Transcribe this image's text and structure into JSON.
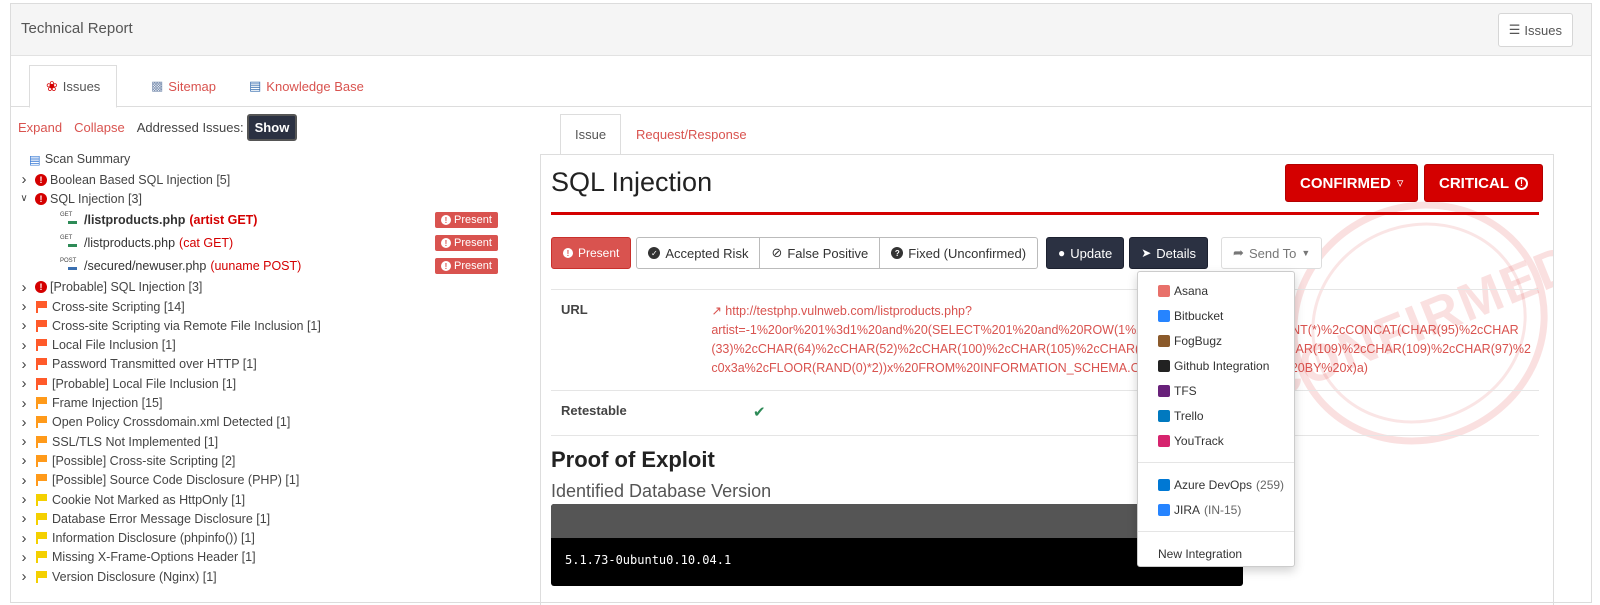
{
  "header": {
    "title": "Technical Report",
    "issues_button": "Issues"
  },
  "tabs_top": [
    {
      "label": "Issues",
      "icon": "bug-icon"
    },
    {
      "label": "Sitemap",
      "icon": "sitemap-icon"
    },
    {
      "label": "Knowledge Base",
      "icon": "book-icon"
    }
  ],
  "controls": {
    "expand": "Expand",
    "collapse": "Collapse",
    "addressed_label": "Addressed Issues:",
    "toggle": "Show"
  },
  "tree": {
    "summary": "Scan Summary",
    "items": [
      {
        "label": "Boolean Based SQL Injection [5]",
        "icon": "critical"
      },
      {
        "label": "SQL Injection [3]",
        "icon": "critical",
        "expanded": true
      },
      {
        "label": "[Probable] SQL Injection [3]",
        "icon": "critical"
      },
      {
        "label": "Cross-site Scripting [14]",
        "icon": "red"
      },
      {
        "label": "Cross-site Scripting via Remote File Inclusion [1]",
        "icon": "red"
      },
      {
        "label": "Local File Inclusion [1]",
        "icon": "red"
      },
      {
        "label": "Password Transmitted over HTTP [1]",
        "icon": "red"
      },
      {
        "label": "[Probable] Local File Inclusion [1]",
        "icon": "red"
      },
      {
        "label": "Frame Injection [15]",
        "icon": "orange"
      },
      {
        "label": "Open Policy Crossdomain.xml Detected [1]",
        "icon": "orange"
      },
      {
        "label": "SSL/TLS Not Implemented [1]",
        "icon": "orange"
      },
      {
        "label": "[Possible] Cross-site Scripting [2]",
        "icon": "orange"
      },
      {
        "label": "[Possible] Source Code Disclosure (PHP) [1]",
        "icon": "orange"
      },
      {
        "label": "Cookie Not Marked as HttpOnly [1]",
        "icon": "yellow"
      },
      {
        "label": "Database Error Message Disclosure [1]",
        "icon": "yellow"
      },
      {
        "label": "Information Disclosure (phpinfo()) [1]",
        "icon": "yellow"
      },
      {
        "label": "Missing X-Frame-Options Header [1]",
        "icon": "yellow"
      },
      {
        "label": "Version Disclosure (Nginx) [1]",
        "icon": "yellow"
      }
    ],
    "sub_items": [
      {
        "method": "GET",
        "path": "/listproducts.php",
        "param": "(artist GET)",
        "badge": "Present",
        "bold": true
      },
      {
        "method": "GET",
        "path": "/listproducts.php",
        "param": "(cat GET)",
        "badge": "Present"
      },
      {
        "method": "POST",
        "path": "/secured/newuser.php",
        "param": "(uuname POST)",
        "badge": "Present"
      }
    ]
  },
  "right_tabs": [
    "Issue",
    "Request/Response"
  ],
  "issue": {
    "title": "SQL Injection",
    "confirmed_badge": "CONFIRMED",
    "severity_badge": "CRITICAL",
    "stamp": "CONFIRMED",
    "actions": {
      "present": "Present",
      "accepted_risk": "Accepted Risk",
      "false_positive": "False Positive",
      "fixed": "Fixed (Unconfirmed)",
      "update": "Update",
      "details": "Details",
      "send_to": "Send To"
    },
    "url_label": "URL",
    "url_lines": [
      "http://testphp.vulnweb.com/listproducts.php?",
      "artist=-1%20or%201%3d1%20and%20(SELECT%201%20and%20ROW(1%2c1)%3e(SELECT%20COUNT(*)%2cCONCAT(CHAR(95)%2cCHAR",
      "(33)%2cCHAR(64)%2cCHAR(52)%2cCHAR(100)%2cCHAR(105)%2cCHAR(108)%2cCHAR(101)%2cCHAR(109)%2cCHAR(109)%2cCHAR(97)%2",
      "c0x3a%2cFLOOR(RAND(0)*2))x%20FROM%20INFORMATION_SCHEMA.COLLATIONS%20GROUP%20BY%20x)a)"
    ],
    "retestable_label": "Retestable",
    "proof_title": "Proof of Exploit",
    "proof_subtitle": "Identified Database Version",
    "db_version": "5.1.73-0ubuntu0.10.04.1"
  },
  "send_to_menu": {
    "items": [
      {
        "label": "Asana",
        "icon": "asana-icon",
        "color": "#e8706a"
      },
      {
        "label": "Bitbucket",
        "icon": "bitbucket-icon",
        "color": "#2684ff"
      },
      {
        "label": "FogBugz",
        "icon": "fogbugz-icon",
        "color": "#8b5a2b"
      },
      {
        "label": "Github Integration",
        "icon": "github-icon",
        "color": "#222222"
      },
      {
        "label": "TFS",
        "icon": "tfs-icon",
        "color": "#68217a"
      },
      {
        "label": "Trello",
        "icon": "trello-icon",
        "color": "#0079bf"
      },
      {
        "label": "YouTrack",
        "icon": "youtrack-icon",
        "color": "#d6246e"
      }
    ],
    "items2": [
      {
        "label": "Azure DevOps",
        "count": "(259)",
        "icon": "azure-devops-icon",
        "color": "#0078d4"
      },
      {
        "label": "JIRA",
        "count": "(IN-15)",
        "icon": "jira-icon",
        "color": "#2684ff"
      }
    ],
    "new_integration": "New Integration"
  },
  "colors": {
    "accent": "#d9534f",
    "critical": "#d40000",
    "dark_button": "#2b3142"
  }
}
